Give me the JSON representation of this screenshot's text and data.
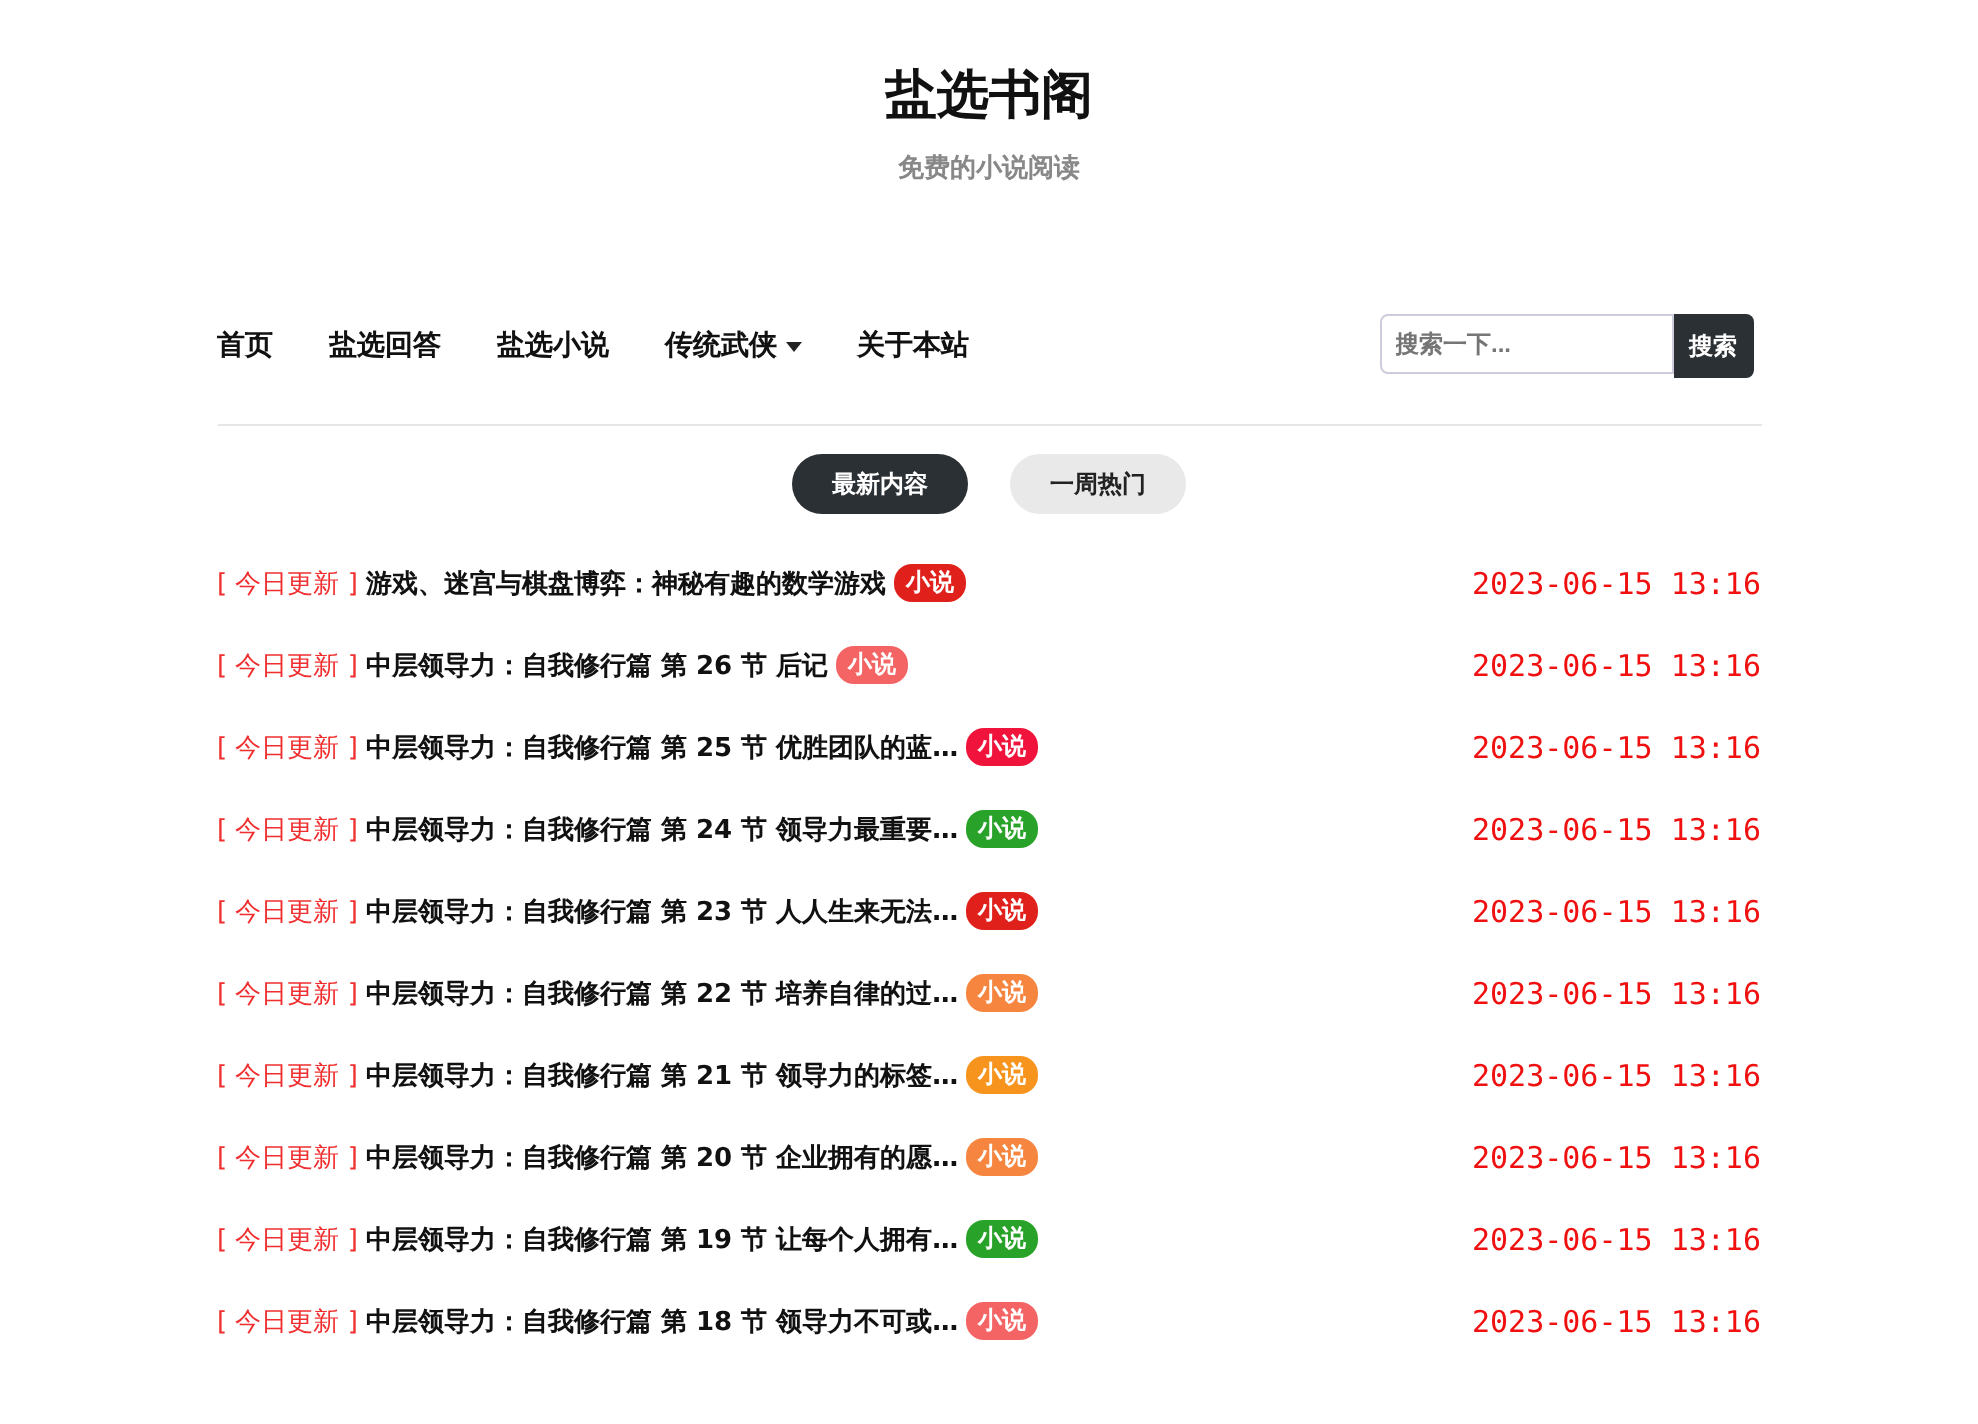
{
  "site": {
    "title": "盐选书阁",
    "subtitle": "免费的小说阅读"
  },
  "nav": [
    {
      "label": "首页",
      "dropdown": false
    },
    {
      "label": "盐选回答",
      "dropdown": false
    },
    {
      "label": "盐选小说",
      "dropdown": false
    },
    {
      "label": "传统武侠",
      "dropdown": true
    },
    {
      "label": "关于本站",
      "dropdown": false
    }
  ],
  "search": {
    "placeholder": "搜索一下...",
    "button": "搜索"
  },
  "tabs": [
    {
      "label": "最新内容",
      "selected": true
    },
    {
      "label": "一周热门",
      "selected": false
    }
  ],
  "posts": [
    {
      "prefix": "[ 今日更新 ]",
      "title": "游戏、迷宫与棋盘博弈：神秘有趣的数学游戏",
      "tag": "小说",
      "color": "#e0201b",
      "date": "2023-06-15 13:16"
    },
    {
      "prefix": "[ 今日更新 ]",
      "title": "中层领导力：自我修行篇 第 26 节 后记",
      "tag": "小说",
      "color": "#f46464",
      "date": "2023-06-15 13:16"
    },
    {
      "prefix": "[ 今日更新 ]",
      "title": "中层领导力：自我修行篇 第 25 节 优胜团队的蓝…",
      "tag": "小说",
      "color": "#f0143c",
      "date": "2023-06-15 13:16"
    },
    {
      "prefix": "[ 今日更新 ]",
      "title": "中层领导力：自我修行篇 第 24 节 领导力最重要…",
      "tag": "小说",
      "color": "#28a228",
      "date": "2023-06-15 13:16"
    },
    {
      "prefix": "[ 今日更新 ]",
      "title": "中层领导力：自我修行篇 第 23 节 人人生来无法…",
      "tag": "小说",
      "color": "#e0201b",
      "date": "2023-06-15 13:16"
    },
    {
      "prefix": "[ 今日更新 ]",
      "title": "中层领导力：自我修行篇 第 22 节 培养自律的过…",
      "tag": "小说",
      "color": "#f5853f",
      "date": "2023-06-15 13:16"
    },
    {
      "prefix": "[ 今日更新 ]",
      "title": "中层领导力：自我修行篇 第 21 节 领导力的标签…",
      "tag": "小说",
      "color": "#f7941d",
      "date": "2023-06-15 13:16"
    },
    {
      "prefix": "[ 今日更新 ]",
      "title": "中层领导力：自我修行篇 第 20 节 企业拥有的愿…",
      "tag": "小说",
      "color": "#f5853f",
      "date": "2023-06-15 13:16"
    },
    {
      "prefix": "[ 今日更新 ]",
      "title": "中层领导力：自我修行篇 第 19 节 让每个人拥有…",
      "tag": "小说",
      "color": "#28a228",
      "date": "2023-06-15 13:16"
    },
    {
      "prefix": "[ 今日更新 ]",
      "title": "中层领导力：自我修行篇 第 18 节 领导力不可或…",
      "tag": "小说",
      "color": "#f46464",
      "date": "2023-06-15 13:16"
    }
  ]
}
